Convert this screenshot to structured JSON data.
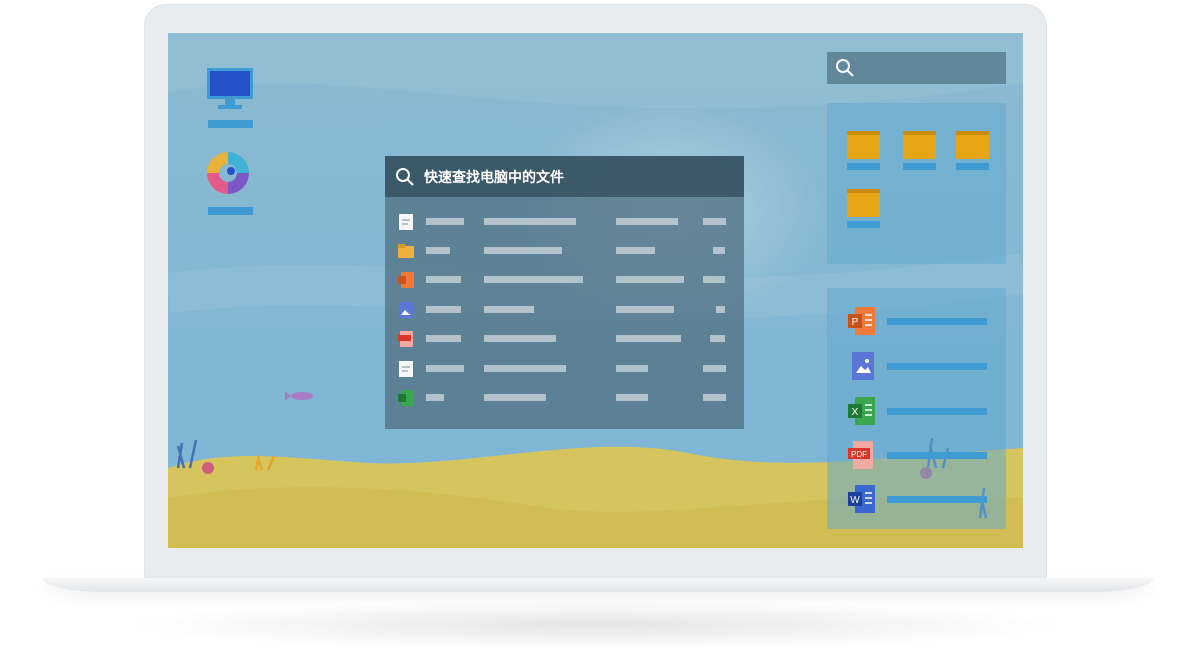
{
  "finder": {
    "title": "快速查找电脑中的文件",
    "rows": [
      {
        "icon": "note-file-icon"
      },
      {
        "icon": "folder-file-icon"
      },
      {
        "icon": "ppt-file-icon"
      },
      {
        "icon": "image-file-icon"
      },
      {
        "icon": "pdf-file-icon"
      },
      {
        "icon": "note-file-icon"
      },
      {
        "icon": "excel-file-icon"
      }
    ]
  },
  "desktop": {
    "icons": [
      "computer-icon",
      "browser-icon"
    ]
  },
  "right_panel": {
    "folders": [
      "folder-icon",
      "folder-icon",
      "folder-icon",
      "folder-icon"
    ],
    "files": [
      "ppt-icon",
      "image-icon",
      "excel-icon",
      "pdf-icon",
      "word-icon"
    ],
    "pdf_badge": "PDF",
    "ppt_badge": "P",
    "excel_badge": "X",
    "word_badge": "W"
  },
  "colors": {
    "accent": "#3f9bd1",
    "folder": "#e6a514",
    "sand": "#d8c35a",
    "sky": "#85b8d2"
  }
}
